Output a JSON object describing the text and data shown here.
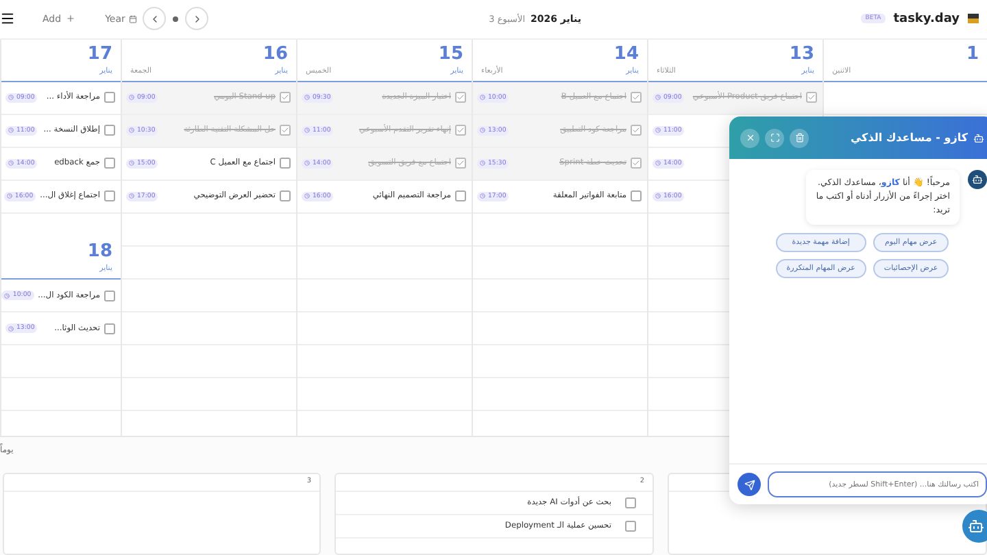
{
  "topbar": {
    "add": "Add",
    "year": "Year",
    "month": "يناير 2026",
    "week": "الأسبوع 3",
    "badge": "BETA",
    "brand": "tasky.day"
  },
  "days": [
    {
      "day": "1",
      "weekday": "الاثنين"
    },
    {
      "day": "13",
      "month": "يناير",
      "weekday": "الثلاثاء",
      "tasks": [
        {
          "title": "اجتماع فريق Product الأسبوعي",
          "time": "09:00",
          "done": true
        },
        {
          "time": "11:00"
        },
        {
          "time": "14:00"
        },
        {
          "time": "16:00"
        }
      ]
    },
    {
      "day": "14",
      "month": "يناير",
      "weekday": "الأربعاء",
      "tasks": [
        {
          "title": "اجتماع مع العميل B",
          "time": "10:00",
          "done": true
        },
        {
          "title": "مراجعة كود التطبيق",
          "time": "13:00",
          "done": true
        },
        {
          "title": "تحديث خطة Sprint",
          "time": "15:30",
          "done": true
        },
        {
          "title": "متابعة الفواتير المعلقة",
          "time": "17:00",
          "done": false
        }
      ]
    },
    {
      "day": "15",
      "month": "يناير",
      "weekday": "الخميس",
      "tasks": [
        {
          "title": "اختبار الميزة الجديدة",
          "time": "09:30",
          "done": true
        },
        {
          "title": "إنهاء تقرير التقدم الأسبوعي",
          "time": "11:00",
          "done": true
        },
        {
          "title": "اجتماع مع فريق التسويق",
          "time": "14:00",
          "done": true
        },
        {
          "title": "مراجعة التصميم النهائي",
          "time": "16:00",
          "done": false
        }
      ]
    },
    {
      "day": "16",
      "month": "يناير",
      "weekday": "الجمعة",
      "tasks": [
        {
          "title": "Stand-up اليومي",
          "time": "09:00",
          "done": true
        },
        {
          "title": "حل المشكلة التقنية الطارئة",
          "time": "10:30",
          "done": true
        },
        {
          "title": "اجتماع مع العميل C",
          "time": "15:00",
          "done": false
        },
        {
          "title": "تحضير العرض التوضيحي",
          "time": "17:00",
          "done": false
        }
      ]
    }
  ],
  "weekend": [
    {
      "day": "17",
      "month": "يناير",
      "tasks": [
        {
          "title": "مراجعة الأداء ...",
          "time": "09:00",
          "done": false
        },
        {
          "title": "إطلاق النسخة ...",
          "time": "11:00",
          "done": false
        },
        {
          "title": "جمع edback",
          "time": "14:00",
          "done": false
        },
        {
          "title": "اجتماع إغلاق ال...",
          "time": "16:00",
          "done": false
        }
      ]
    },
    {
      "day": "18",
      "month": "يناير",
      "tasks": [
        {
          "title": "مراجعة الكود ال...",
          "time": "10:00",
          "done": false
        },
        {
          "title": "تحديث الوثا...",
          "time": "13:00",
          "done": false
        }
      ]
    }
  ],
  "backlog": {
    "label": "يوماً",
    "cards": [
      {
        "number": "2",
        "tasks": [
          {
            "title": "بحث عن أدوات AI جديدة",
            "done": false
          },
          {
            "title": "تحسين عملية الـ Deployment",
            "done": false
          }
        ]
      },
      {
        "number": "3"
      }
    ]
  },
  "chat": {
    "title": "كازو - مساعدك الذكي",
    "message": "مرحباً! 👋 أنا **كازو**، مساعدك الذكي. اختر إجراءً من الأزرار أدناه أو اكتب ما تريد:",
    "actions": [
      "عرض مهام اليوم",
      "إضافة مهمة جديدة",
      "عرض الإحصائيات",
      "عرض المهام المتكررة"
    ],
    "placeholder": "اكتب رسالتك هنا... (Shift+Enter لسطر جديد)"
  }
}
